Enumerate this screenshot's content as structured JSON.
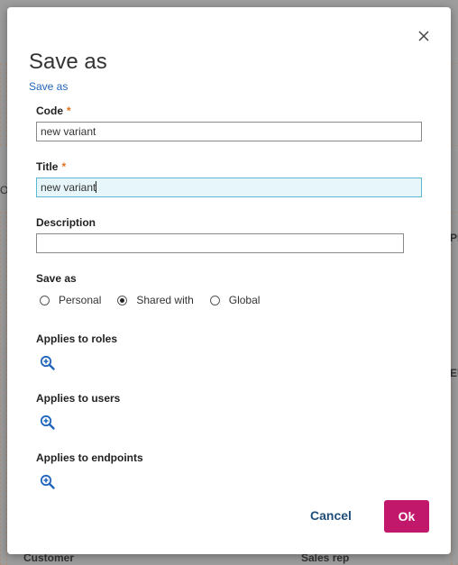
{
  "background": {
    "left_char": "O",
    "right_char_1": "PI",
    "right_char_2": "EU",
    "bottom_left_label": "Customer",
    "bottom_right_label": "Sales rep"
  },
  "dialog": {
    "title": "Save as",
    "breadcrumb": "Save as",
    "close_icon": "close-icon",
    "code": {
      "label": "Code",
      "required_mark": "*",
      "value": "new variant"
    },
    "title_field": {
      "label": "Title",
      "required_mark": "*",
      "value": "new variant"
    },
    "description": {
      "label": "Description",
      "value": ""
    },
    "save_as": {
      "label": "Save as",
      "options": [
        {
          "label": "Personal",
          "selected": false
        },
        {
          "label": "Shared with",
          "selected": true
        },
        {
          "label": "Global",
          "selected": false
        }
      ]
    },
    "applies_to_roles": {
      "label": "Applies to roles",
      "icon": "zoom-in-icon"
    },
    "applies_to_users": {
      "label": "Applies to users",
      "icon": "zoom-in-icon"
    },
    "applies_to_endpoints": {
      "label": "Applies to endpoints",
      "icon": "zoom-in-icon"
    },
    "cancel_label": "Cancel",
    "ok_label": "Ok"
  },
  "colors": {
    "accent": "#c2186b",
    "link": "#2266bb",
    "required": "#e3711c",
    "focus_bg": "#e6f6fb"
  }
}
